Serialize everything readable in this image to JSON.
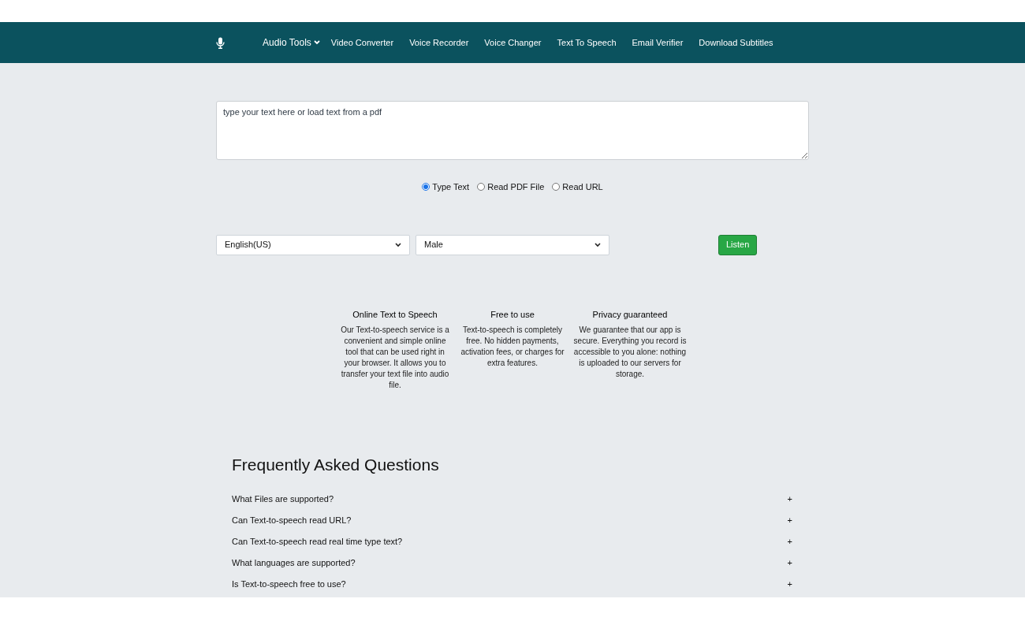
{
  "nav": {
    "items": [
      {
        "label": "Audio Tools",
        "kind": "dropdown"
      },
      {
        "label": "Video Converter",
        "kind": "link"
      },
      {
        "label": "Voice Recorder",
        "kind": "link"
      },
      {
        "label": "Voice Changer",
        "kind": "link"
      },
      {
        "label": "Text To Speech",
        "kind": "link"
      },
      {
        "label": "Email Verifier",
        "kind": "link"
      },
      {
        "label": "Download Subtitles",
        "kind": "link"
      }
    ]
  },
  "text_input": {
    "placeholder": "type your text here or load text from a pdf"
  },
  "source_options": [
    {
      "label": "Type Text",
      "selected": true
    },
    {
      "label": "Read PDF File",
      "selected": false
    },
    {
      "label": "Read URL",
      "selected": false
    }
  ],
  "language_select": {
    "value": "English(US)"
  },
  "voice_select": {
    "value": "Male"
  },
  "listen_button": "Listen",
  "features": [
    {
      "title": "Online Text to Speech",
      "text": "Our Text-to-speech service is a convenient and simple online tool that can be used right in your browser. It allows you to transfer your text file into audio file."
    },
    {
      "title": "Free to use",
      "text": "Text-to-speech is completely free. No hidden payments, activation fees, or charges for extra features."
    },
    {
      "title": "Privacy guaranteed",
      "text": "We guarantee that our app is secure. Everything you record is accessible to you alone: nothing is uploaded to our servers for storage."
    }
  ],
  "faq": {
    "title": "Frequently Asked Questions",
    "items": [
      {
        "question": "What Files are supported?",
        "toggle": "+"
      },
      {
        "question": "Can Text-to-speech read URL?",
        "toggle": "+"
      },
      {
        "question": "Can Text-to-speech read real time type text?",
        "toggle": "+"
      },
      {
        "question": "What languages are supported?",
        "toggle": "+"
      },
      {
        "question": "Is Text-to-speech free to use?",
        "toggle": "+"
      }
    ]
  }
}
